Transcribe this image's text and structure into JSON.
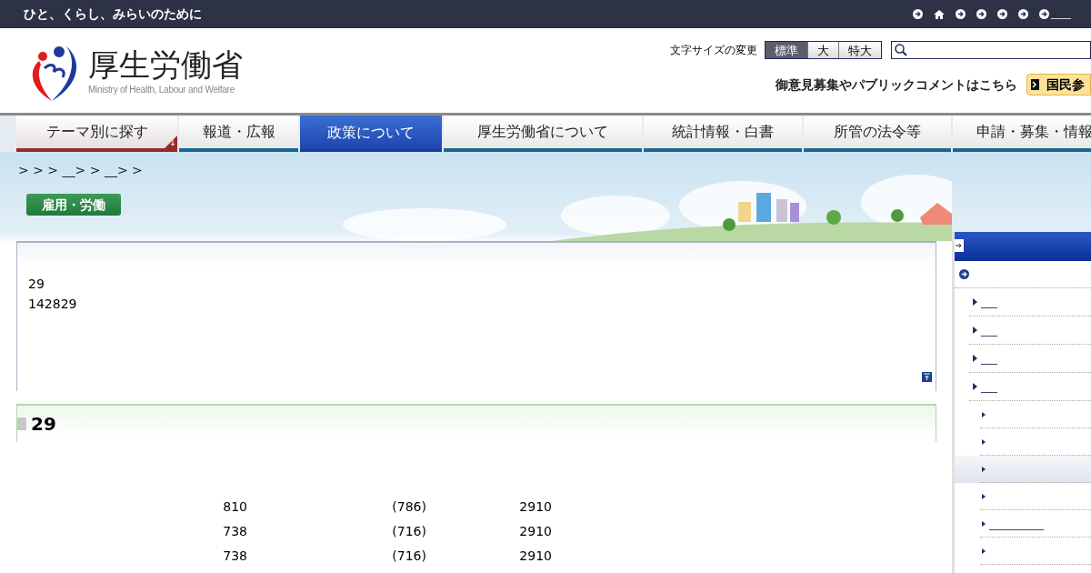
{
  "top_bar": {
    "tagline": "ひと、くらし、みらいのために",
    "links": [
      {
        "kind": "arrow"
      },
      {
        "kind": "home"
      },
      {
        "kind": "arrow"
      },
      {
        "kind": "arrow"
      },
      {
        "kind": "arrow"
      },
      {
        "kind": "arrow"
      },
      {
        "kind": "arrow",
        "label": "____"
      }
    ]
  },
  "header": {
    "logo_title": "厚生労働省",
    "logo_subtitle": "Ministry of Health, Labour and Welfare",
    "font_size_label": "文字サイズの変更",
    "font_sizes": [
      {
        "label": "標準",
        "selected": true
      },
      {
        "label": "大",
        "selected": false
      },
      {
        "label": "特大",
        "selected": false
      }
    ],
    "opinion_text": "御意見募集やパブリックコメントはこちら",
    "participation_button": "国民参"
  },
  "nav": [
    {
      "label": "テーマ別に探す",
      "kind": "theme",
      "selected": false
    },
    {
      "label": "報道・広報",
      "kind": "tab",
      "selected": false
    },
    {
      "label": "政策について",
      "kind": "tab",
      "selected": true
    },
    {
      "label": "厚生労働省について",
      "kind": "tab",
      "selected": false
    },
    {
      "label": "統計情報・白書",
      "kind": "tab",
      "selected": false
    },
    {
      "label": "所管の法令等",
      "kind": "tab",
      "selected": false
    },
    {
      "label": "申請・募集・情報",
      "kind": "tab",
      "selected": false
    }
  ],
  "breadcrumb": "> > > __> > __> >",
  "category_badge": "雇用・労働",
  "intro": {
    "lines": [
      "29",
      "142829"
    ]
  },
  "section": {
    "heading": "29",
    "rows": [
      [
        "810",
        "(786)",
        "2910"
      ],
      [
        "738",
        "(716)",
        "2910"
      ],
      [
        "738",
        "(716)",
        "2910"
      ]
    ]
  },
  "sidebar": {
    "items": [
      {
        "label": "___"
      },
      {
        "label": "___"
      },
      {
        "label": "___"
      },
      {
        "label": "___",
        "children": [
          {
            "selected": false
          },
          {
            "selected": false
          },
          {
            "selected": true
          },
          {
            "selected": false
          },
          {
            "label": "__________",
            "selected": false
          },
          {
            "selected": false
          }
        ]
      }
    ]
  }
}
